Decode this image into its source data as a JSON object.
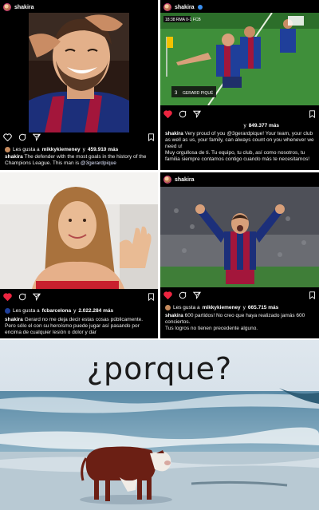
{
  "posts": [
    {
      "username": "shakira",
      "likes_prefix": "Les gusta a",
      "likes_user": "mikkykiemeney",
      "likes_mid": "y",
      "likes_count": "459.910 más",
      "caption_user": "shakira",
      "caption": "The defender with the most goals in the history of the Champions League. This man is",
      "caption_tag": "@3gerardpique"
    },
    {
      "username": "shakira",
      "likes_count": "849.377 más",
      "likes_mid": "y",
      "caption_user": "shakira",
      "caption": "Very proud of you @3gerardpique! Your team, your club as well as us, your family, can always count on you whenever we need u!",
      "caption_es": "Muy orgullosa de ti. Tu equipo, tu club, así como nosotros, tu familia siempre contamos contigo cuando más te necesitamos!",
      "scoreboard_name": "GERARD PIQUÉ",
      "scoreboard_num": "3",
      "scoreboard_score": "18:38 RMA 0-1 FCB"
    },
    {
      "likes_prefix": "Les gusta a",
      "likes_user": "fcbarcelona",
      "likes_mid": "y",
      "likes_count": "2.022.284 más",
      "caption_user": "shakira",
      "caption": "Gerard no me deja decir estas cosas públicamente. Pero sólo el con su heroísmo puede jugar así pasando por encima de cualquier lesión o dolor y dar"
    },
    {
      "username": "shakira",
      "likes_prefix": "Les gusta a",
      "likes_user": "mikkykiemeney",
      "likes_mid": "y",
      "likes_count": "665.715 más",
      "caption_user": "shakira",
      "caption": "600 partidos! No creo que haya realizado jamás 600 conciertos.",
      "caption2": "Tus logros no tienen precedente alguno."
    }
  ],
  "meme": {
    "text": "¿porque?"
  },
  "colors": {
    "like_red": "#ed2540",
    "verified_blue": "#3a8ff0",
    "avatar_ring": "#d23f7a"
  },
  "icons": [
    "heart-icon",
    "comment-icon",
    "share-icon",
    "bookmark-icon"
  ]
}
